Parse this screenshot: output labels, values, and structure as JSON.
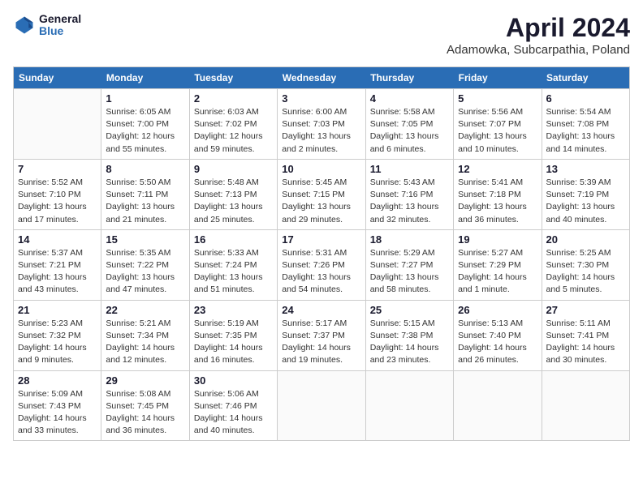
{
  "header": {
    "logo": {
      "general": "General",
      "blue": "Blue"
    },
    "title": "April 2024",
    "location": "Adamowka, Subcarpathia, Poland"
  },
  "days_of_week": [
    "Sunday",
    "Monday",
    "Tuesday",
    "Wednesday",
    "Thursday",
    "Friday",
    "Saturday"
  ],
  "weeks": [
    [
      {
        "num": "",
        "info": ""
      },
      {
        "num": "1",
        "info": "Sunrise: 6:05 AM\nSunset: 7:00 PM\nDaylight: 12 hours\nand 55 minutes."
      },
      {
        "num": "2",
        "info": "Sunrise: 6:03 AM\nSunset: 7:02 PM\nDaylight: 12 hours\nand 59 minutes."
      },
      {
        "num": "3",
        "info": "Sunrise: 6:00 AM\nSunset: 7:03 PM\nDaylight: 13 hours\nand 2 minutes."
      },
      {
        "num": "4",
        "info": "Sunrise: 5:58 AM\nSunset: 7:05 PM\nDaylight: 13 hours\nand 6 minutes."
      },
      {
        "num": "5",
        "info": "Sunrise: 5:56 AM\nSunset: 7:07 PM\nDaylight: 13 hours\nand 10 minutes."
      },
      {
        "num": "6",
        "info": "Sunrise: 5:54 AM\nSunset: 7:08 PM\nDaylight: 13 hours\nand 14 minutes."
      }
    ],
    [
      {
        "num": "7",
        "info": "Sunrise: 5:52 AM\nSunset: 7:10 PM\nDaylight: 13 hours\nand 17 minutes."
      },
      {
        "num": "8",
        "info": "Sunrise: 5:50 AM\nSunset: 7:11 PM\nDaylight: 13 hours\nand 21 minutes."
      },
      {
        "num": "9",
        "info": "Sunrise: 5:48 AM\nSunset: 7:13 PM\nDaylight: 13 hours\nand 25 minutes."
      },
      {
        "num": "10",
        "info": "Sunrise: 5:45 AM\nSunset: 7:15 PM\nDaylight: 13 hours\nand 29 minutes."
      },
      {
        "num": "11",
        "info": "Sunrise: 5:43 AM\nSunset: 7:16 PM\nDaylight: 13 hours\nand 32 minutes."
      },
      {
        "num": "12",
        "info": "Sunrise: 5:41 AM\nSunset: 7:18 PM\nDaylight: 13 hours\nand 36 minutes."
      },
      {
        "num": "13",
        "info": "Sunrise: 5:39 AM\nSunset: 7:19 PM\nDaylight: 13 hours\nand 40 minutes."
      }
    ],
    [
      {
        "num": "14",
        "info": "Sunrise: 5:37 AM\nSunset: 7:21 PM\nDaylight: 13 hours\nand 43 minutes."
      },
      {
        "num": "15",
        "info": "Sunrise: 5:35 AM\nSunset: 7:22 PM\nDaylight: 13 hours\nand 47 minutes."
      },
      {
        "num": "16",
        "info": "Sunrise: 5:33 AM\nSunset: 7:24 PM\nDaylight: 13 hours\nand 51 minutes."
      },
      {
        "num": "17",
        "info": "Sunrise: 5:31 AM\nSunset: 7:26 PM\nDaylight: 13 hours\nand 54 minutes."
      },
      {
        "num": "18",
        "info": "Sunrise: 5:29 AM\nSunset: 7:27 PM\nDaylight: 13 hours\nand 58 minutes."
      },
      {
        "num": "19",
        "info": "Sunrise: 5:27 AM\nSunset: 7:29 PM\nDaylight: 14 hours\nand 1 minute."
      },
      {
        "num": "20",
        "info": "Sunrise: 5:25 AM\nSunset: 7:30 PM\nDaylight: 14 hours\nand 5 minutes."
      }
    ],
    [
      {
        "num": "21",
        "info": "Sunrise: 5:23 AM\nSunset: 7:32 PM\nDaylight: 14 hours\nand 9 minutes."
      },
      {
        "num": "22",
        "info": "Sunrise: 5:21 AM\nSunset: 7:34 PM\nDaylight: 14 hours\nand 12 minutes."
      },
      {
        "num": "23",
        "info": "Sunrise: 5:19 AM\nSunset: 7:35 PM\nDaylight: 14 hours\nand 16 minutes."
      },
      {
        "num": "24",
        "info": "Sunrise: 5:17 AM\nSunset: 7:37 PM\nDaylight: 14 hours\nand 19 minutes."
      },
      {
        "num": "25",
        "info": "Sunrise: 5:15 AM\nSunset: 7:38 PM\nDaylight: 14 hours\nand 23 minutes."
      },
      {
        "num": "26",
        "info": "Sunrise: 5:13 AM\nSunset: 7:40 PM\nDaylight: 14 hours\nand 26 minutes."
      },
      {
        "num": "27",
        "info": "Sunrise: 5:11 AM\nSunset: 7:41 PM\nDaylight: 14 hours\nand 30 minutes."
      }
    ],
    [
      {
        "num": "28",
        "info": "Sunrise: 5:09 AM\nSunset: 7:43 PM\nDaylight: 14 hours\nand 33 minutes."
      },
      {
        "num": "29",
        "info": "Sunrise: 5:08 AM\nSunset: 7:45 PM\nDaylight: 14 hours\nand 36 minutes."
      },
      {
        "num": "30",
        "info": "Sunrise: 5:06 AM\nSunset: 7:46 PM\nDaylight: 14 hours\nand 40 minutes."
      },
      {
        "num": "",
        "info": ""
      },
      {
        "num": "",
        "info": ""
      },
      {
        "num": "",
        "info": ""
      },
      {
        "num": "",
        "info": ""
      }
    ]
  ]
}
